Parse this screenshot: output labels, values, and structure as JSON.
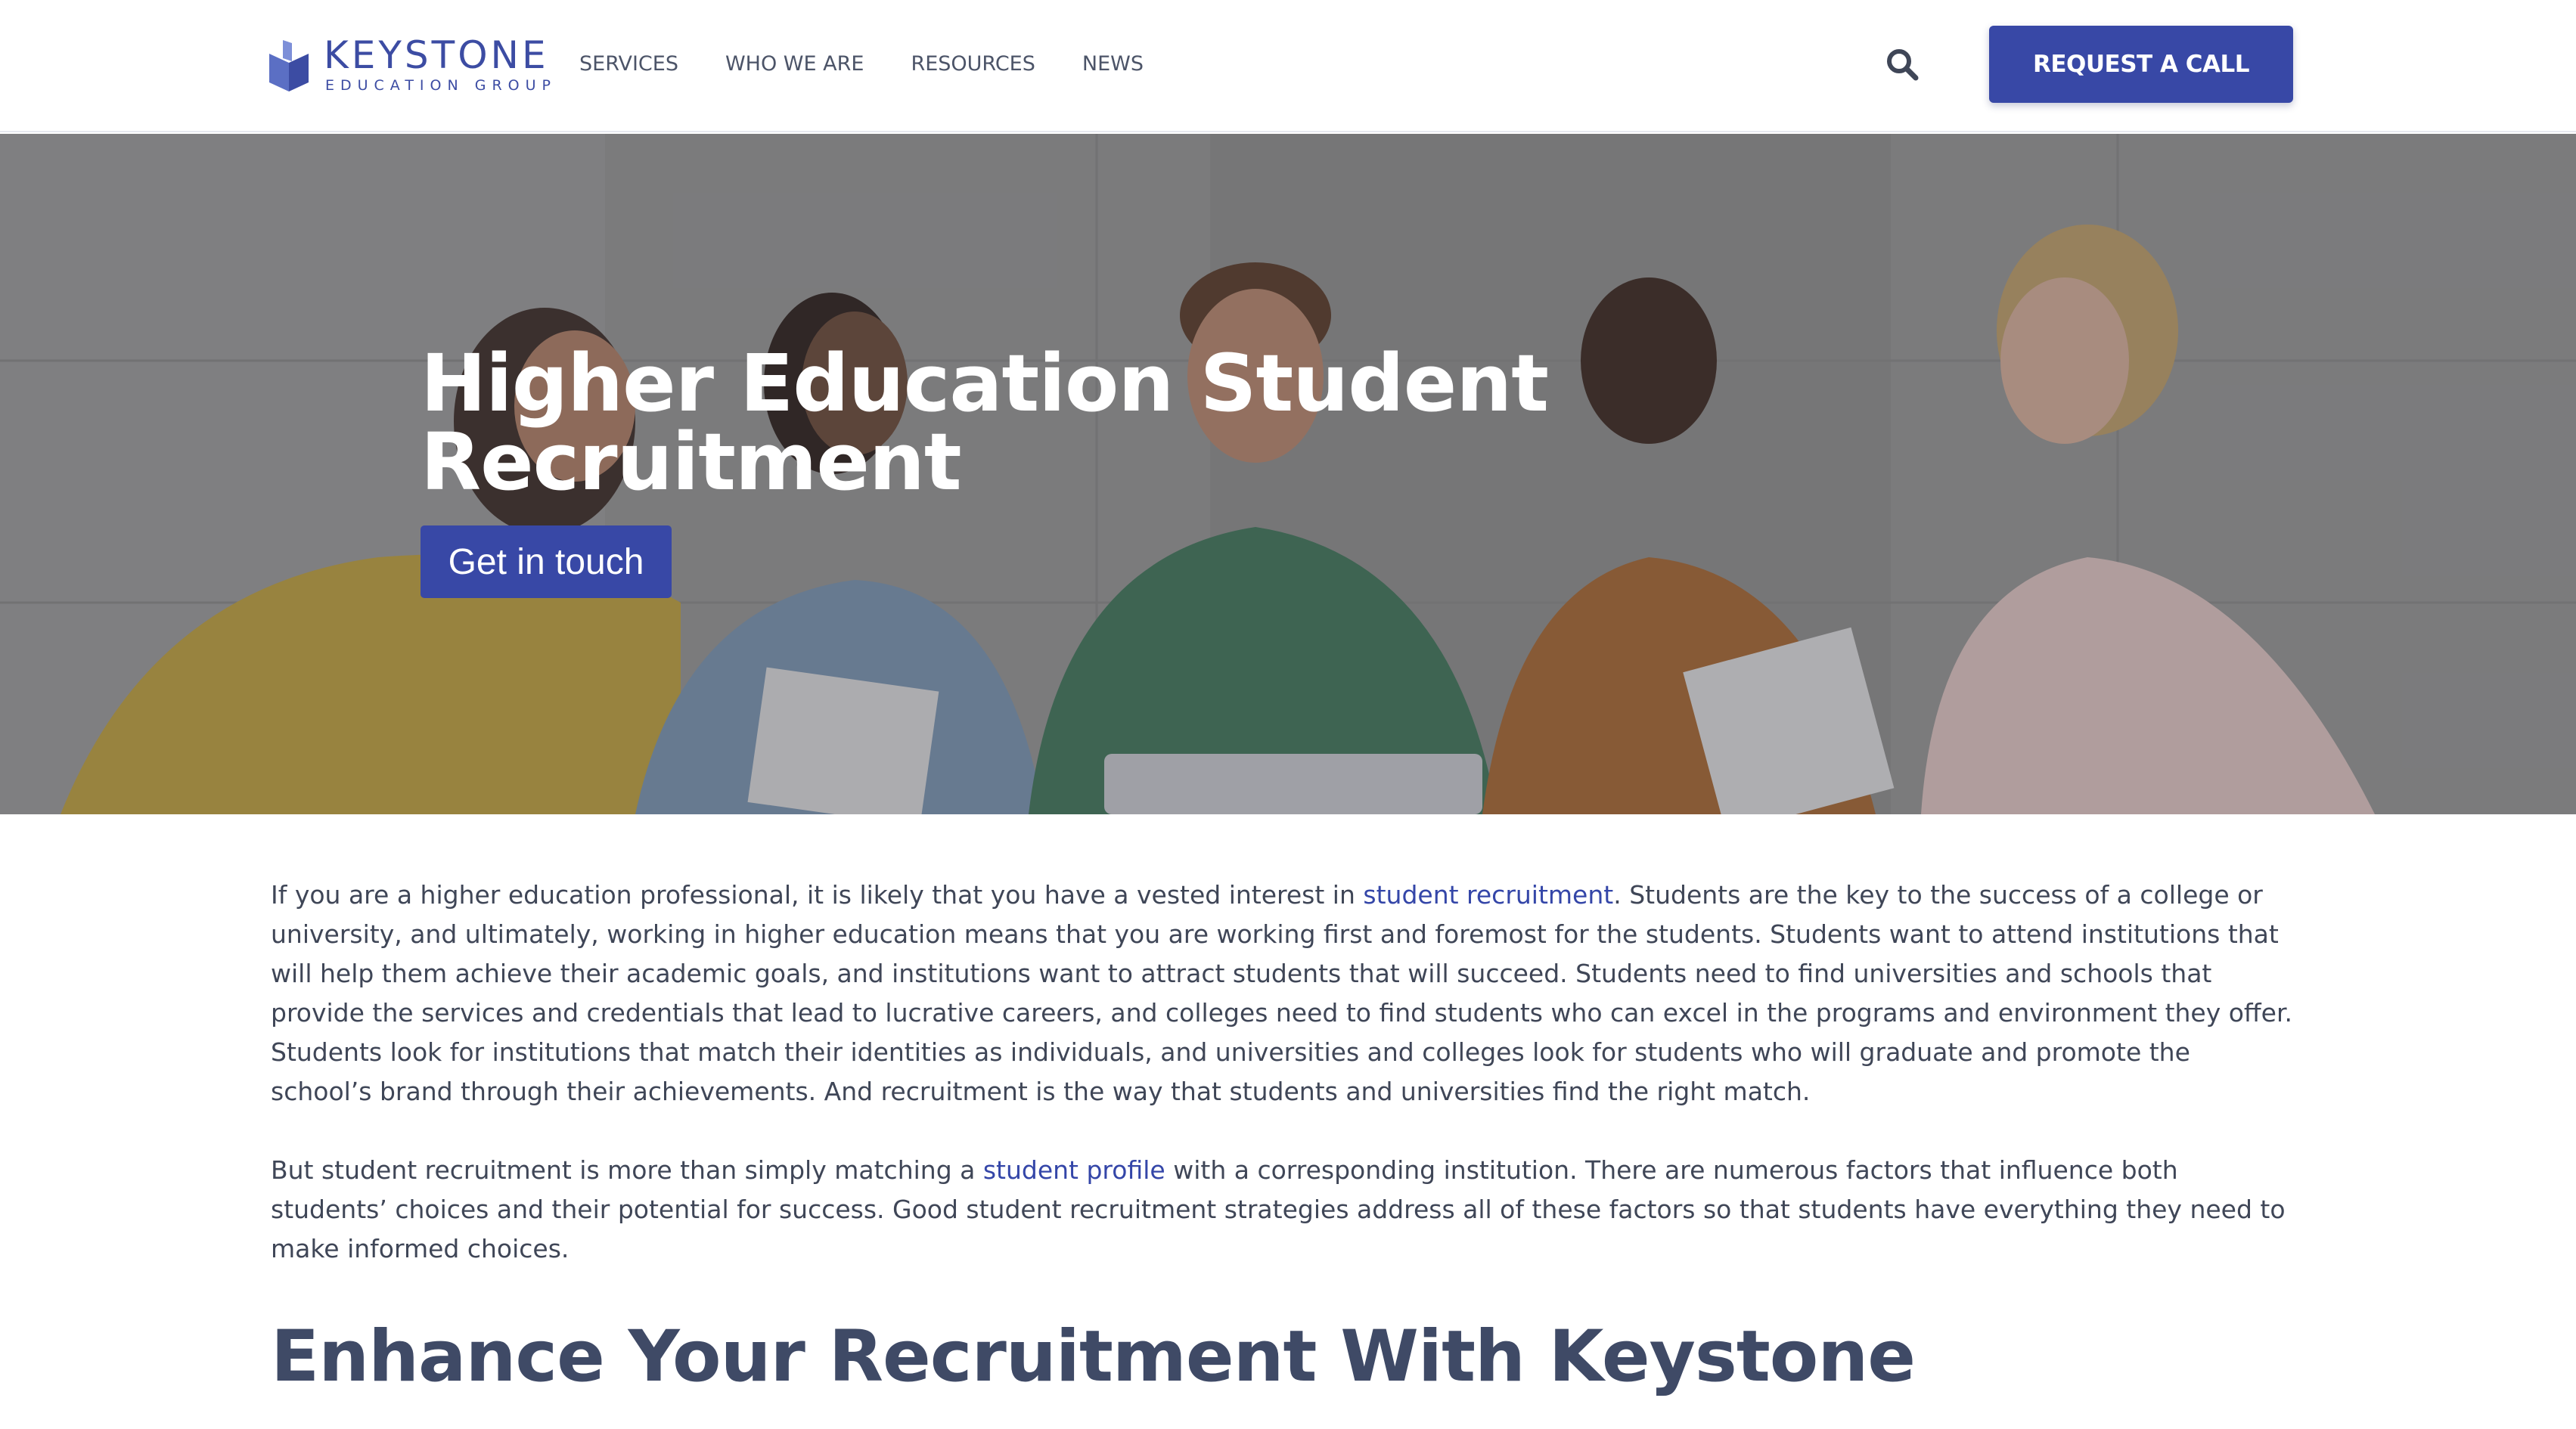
{
  "header": {
    "logo": {
      "word": "KEYSTONE",
      "sub": "EDUCATION GROUP"
    },
    "nav": [
      {
        "label": "SERVICES"
      },
      {
        "label": "WHO WE ARE"
      },
      {
        "label": "RESOURCES"
      },
      {
        "label": "NEWS"
      }
    ],
    "search_icon": "search-icon",
    "cta_label": "REQUEST A CALL"
  },
  "hero": {
    "title_line1": "Higher Education Student",
    "title_line2": "Recruitment",
    "button_label": "Get in touch"
  },
  "content": {
    "p1": {
      "before": "If you are a higher education professional, it is likely that you have a vested interest in ",
      "link": "student recruitment",
      "after": ". Students are the key to the success of a college or university, and ultimately, working in higher education means that you are working first and foremost for the students. Students want to attend institutions that will help them achieve their academic goals, and institutions want to attract students that will succeed. Students need to find universities and schools that provide the services and credentials that lead to lucrative careers, and colleges need to find students who can excel in the programs and environment they offer. Students look for institutions that match their identities as individuals, and universities and colleges look for students who will graduate and promote the school’s brand through their achievements. And recruitment is the way that students and universities find the right match."
    },
    "p2": {
      "before": "But student recruitment is more than simply matching a ",
      "link": "student profile",
      "after": " with a corresponding institution. There are numerous factors that influence both students’ choices and their potential for success. Good student recruitment strategies address all of these factors so that students have everything they need to make informed choices."
    },
    "heading": "Enhance Your Recruitment With Keystone"
  },
  "colors": {
    "brand": "#3848a6",
    "link": "#3446a8",
    "text": "#3f4657",
    "heading": "#3f4a66"
  }
}
